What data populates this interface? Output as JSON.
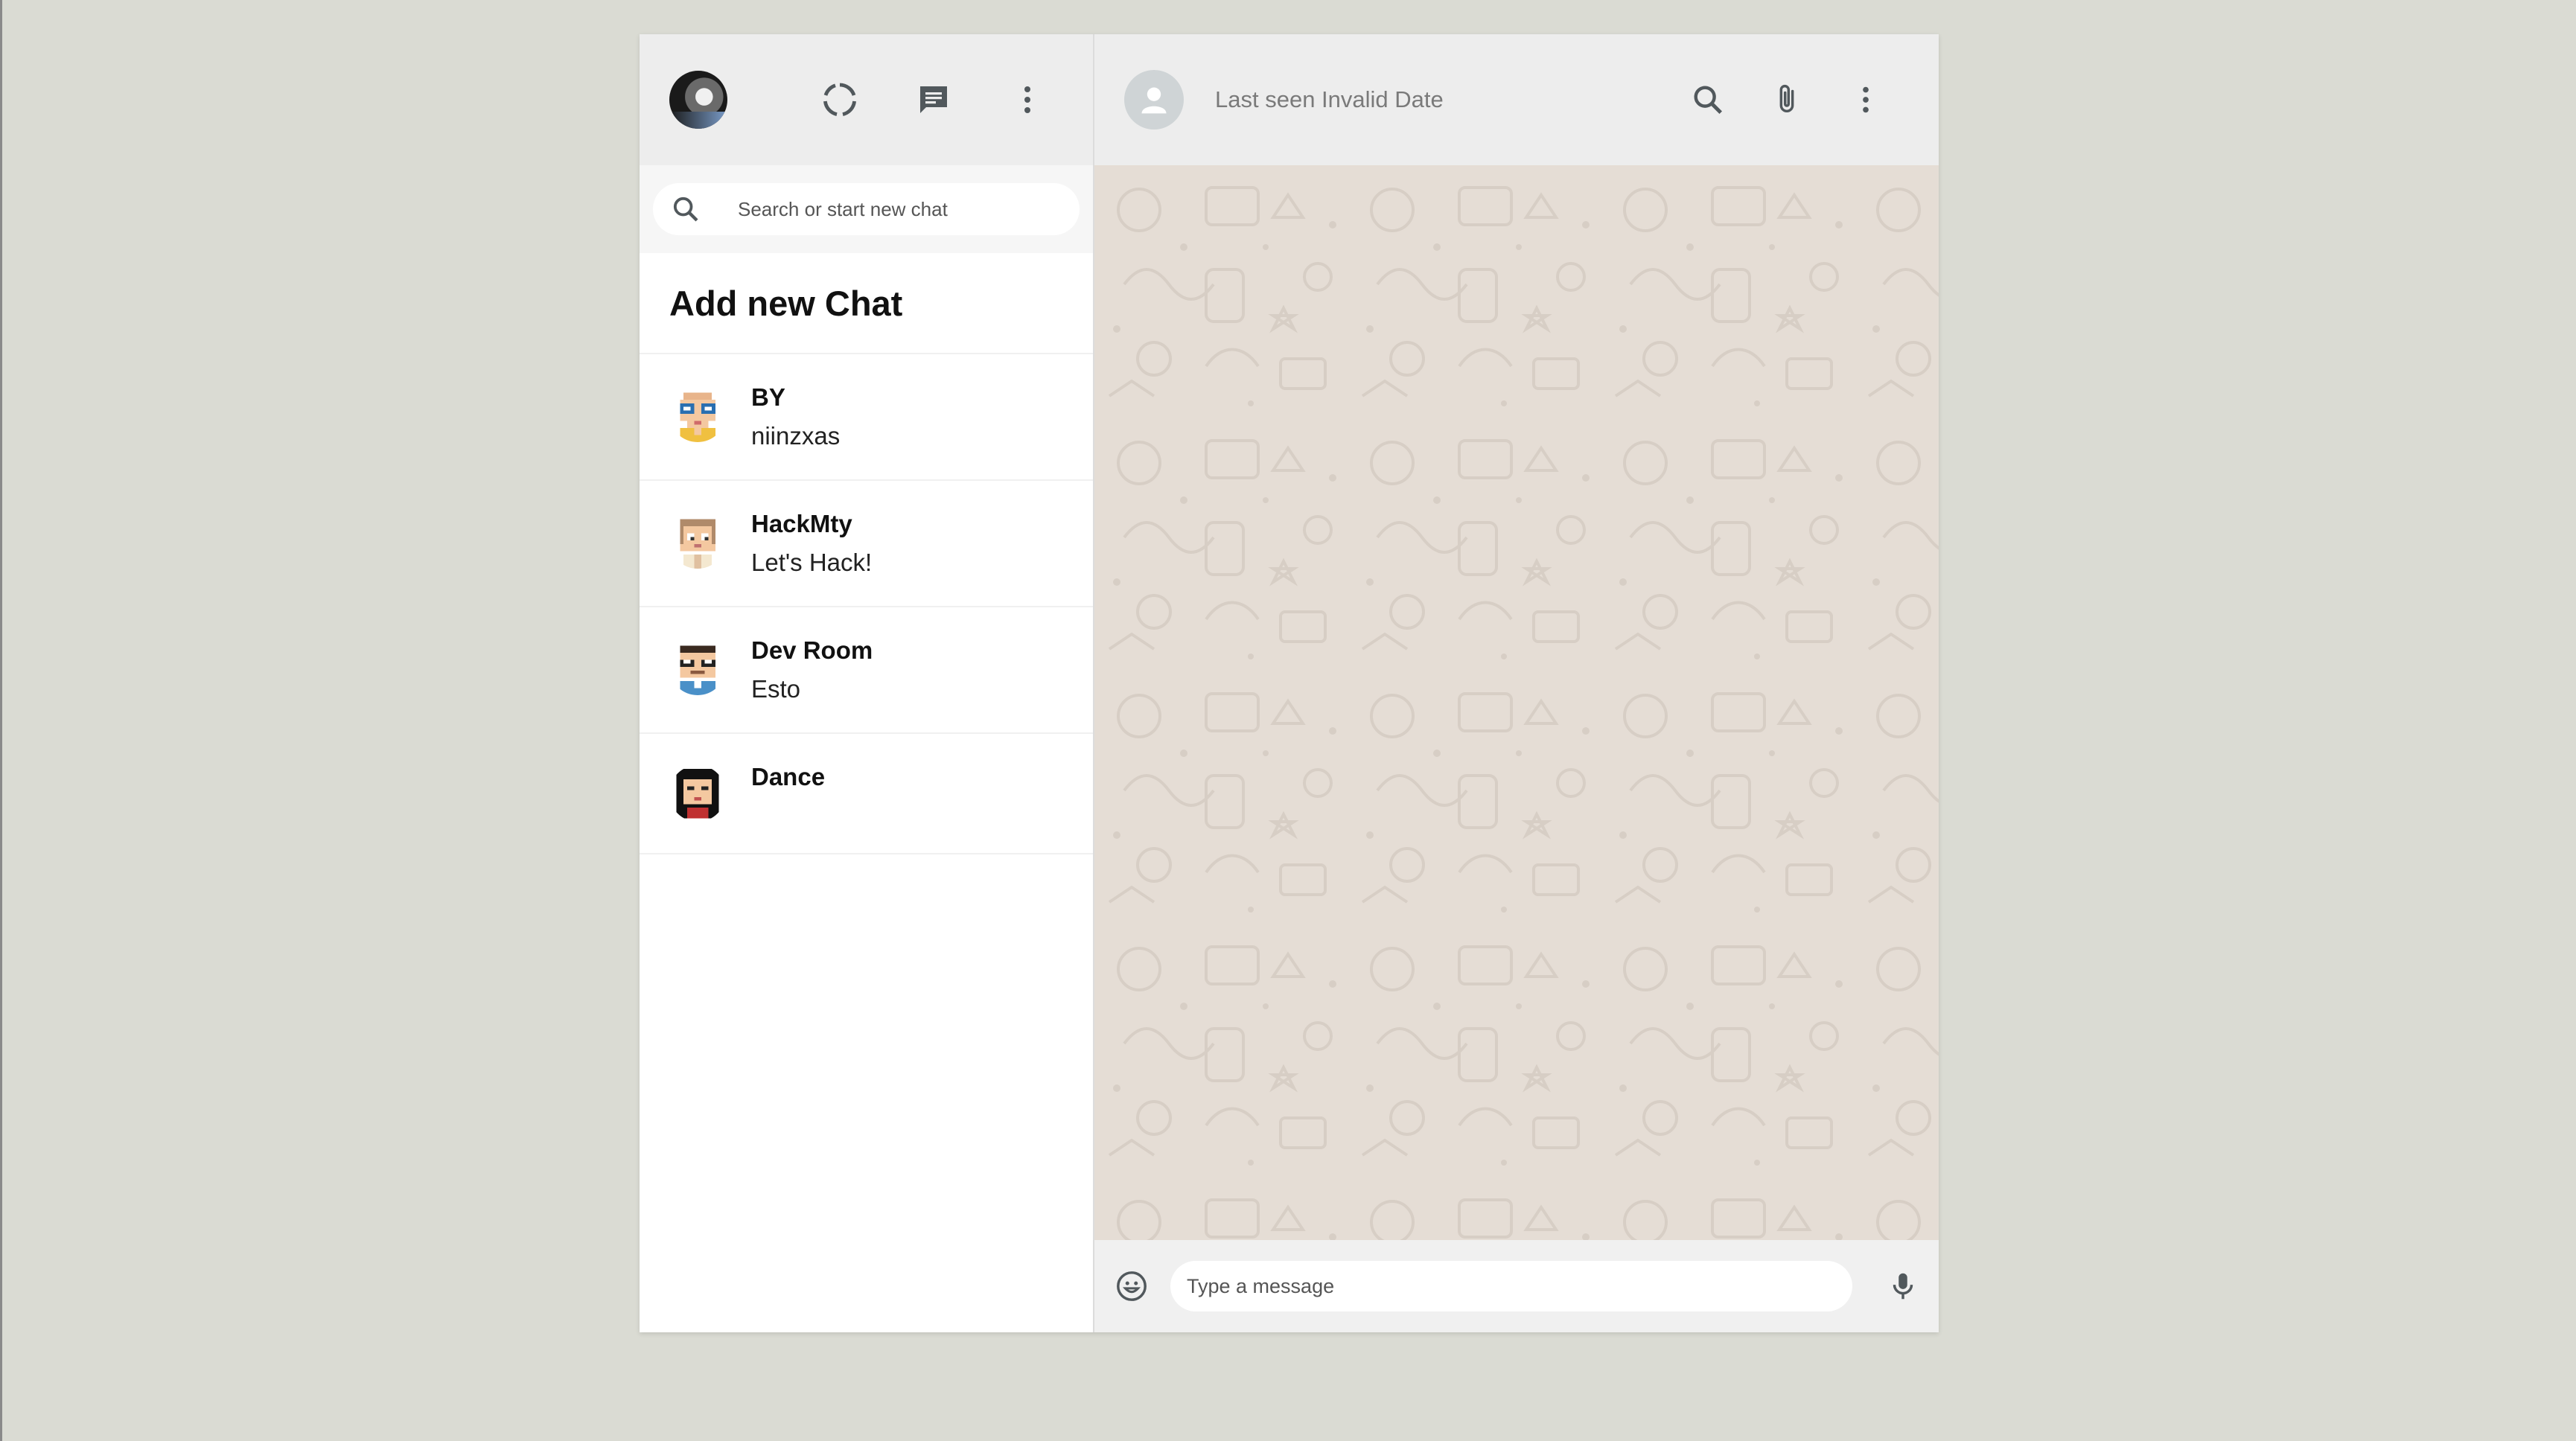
{
  "sidebar": {
    "search": {
      "placeholder": "Search or start new chat"
    },
    "add_chat_label": "Add new Chat",
    "header_icons": [
      "status-icon",
      "chat-icon",
      "menu-dots-icon"
    ],
    "chats": [
      {
        "name": "BY",
        "last_message": "niinzxas"
      },
      {
        "name": "HackMty",
        "last_message": "Let's Hack!"
      },
      {
        "name": "Dev Room",
        "last_message": "Esto"
      },
      {
        "name": "Dance",
        "last_message": ""
      }
    ]
  },
  "main": {
    "header": {
      "last_seen": "Last seen Invalid Date"
    },
    "header_icons": [
      "search-icon",
      "attach-icon",
      "menu-dots-icon"
    ],
    "composer": {
      "placeholder": "Type a message"
    }
  },
  "colors": {
    "header_bg": "#ededed",
    "chat_bg": "#e5ddd5",
    "page_bg": "#dadbd3",
    "icon": "#51585c"
  }
}
